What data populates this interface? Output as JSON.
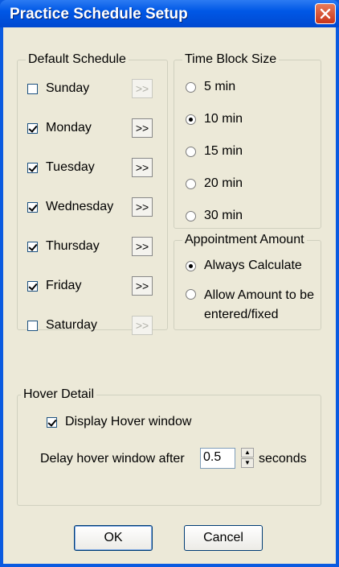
{
  "window": {
    "title": "Practice Schedule Setup"
  },
  "default_schedule": {
    "legend": "Default Schedule",
    "days": [
      {
        "label": "Sunday",
        "checked": false,
        "arrow": ">>",
        "arrow_enabled": false
      },
      {
        "label": "Monday",
        "checked": true,
        "arrow": ">>",
        "arrow_enabled": true
      },
      {
        "label": "Tuesday",
        "checked": true,
        "arrow": ">>",
        "arrow_enabled": true
      },
      {
        "label": "Wednesday",
        "checked": true,
        "arrow": ">>",
        "arrow_enabled": true
      },
      {
        "label": "Thursday",
        "checked": true,
        "arrow": ">>",
        "arrow_enabled": true
      },
      {
        "label": "Friday",
        "checked": true,
        "arrow": ">>",
        "arrow_enabled": true
      },
      {
        "label": "Saturday",
        "checked": false,
        "arrow": ">>",
        "arrow_enabled": false
      }
    ]
  },
  "time_block": {
    "legend": "Time Block Size",
    "options": [
      "5 min",
      "10 min",
      "15 min",
      "20 min",
      "30 min"
    ],
    "selected": "10 min"
  },
  "appointment_amount": {
    "legend": "Appointment Amount",
    "option1": "Always Calculate",
    "option2_line1": "Allow Amount to be",
    "option2_line2": "entered/fixed",
    "selected": "Always Calculate"
  },
  "hover_detail": {
    "legend": "Hover Detail",
    "display_label": "Display Hover window",
    "display_checked": true,
    "delay_label": "Delay hover window after",
    "delay_value": "0.5",
    "delay_unit": "seconds"
  },
  "buttons": {
    "ok": "OK",
    "cancel": "Cancel"
  },
  "icons": {
    "close": "close-icon",
    "spin_up": "spin-up-icon",
    "spin_down": "spin-down-icon"
  },
  "colors": {
    "titlebar": "#0058e6",
    "close": "#c9351a",
    "face": "#ece9d8"
  }
}
